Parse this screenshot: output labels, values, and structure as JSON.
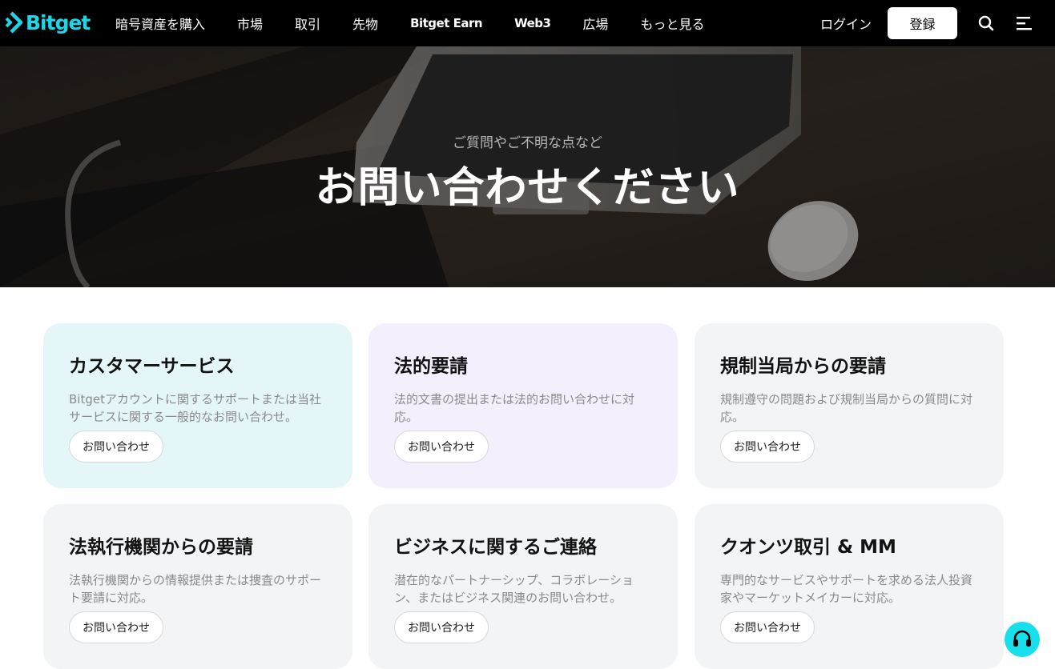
{
  "header": {
    "logo_text": "Bitget",
    "nav": [
      {
        "label": "暗号資産を購入",
        "bold": false
      },
      {
        "label": "市場",
        "bold": false
      },
      {
        "label": "取引",
        "bold": false
      },
      {
        "label": "先物",
        "bold": false
      },
      {
        "label": "Bitget Earn",
        "bold": true
      },
      {
        "label": "Web3",
        "bold": true
      },
      {
        "label": "広場",
        "bold": false
      },
      {
        "label": "もっと見る",
        "bold": false
      }
    ],
    "login_label": "ログイン",
    "register_label": "登録"
  },
  "hero": {
    "subtitle": "ご質問やご不明な点など",
    "title": "お問い合わせください"
  },
  "cards": [
    {
      "title": "カスタマーサービス",
      "description": "Bitgetアカウントに関するサポートまたは当社サービスに関する一般的なお問い合わせ。",
      "button": "お問い合わせ",
      "tone": "cyan"
    },
    {
      "title": "法的要請",
      "description": "法的文書の提出または法的お問い合わせに対応。",
      "button": "お問い合わせ",
      "tone": "lavender"
    },
    {
      "title": "規制当局からの要請",
      "description": "規制遵守の問題および規制当局からの質問に対応。",
      "button": "お問い合わせ",
      "tone": "grey"
    },
    {
      "title": "法執行機関からの要請",
      "description": "法執行機関からの情報提供または捜査のサポート要請に対応。",
      "button": "お問い合わせ",
      "tone": "grey"
    },
    {
      "title": "ビジネスに関するご連絡",
      "description": "潜在的なパートナーシップ、コラボレーション、またはビジネス関連のお問い合わせ。",
      "button": "お問い合わせ",
      "tone": "grey"
    },
    {
      "title": "クオンツ取引 & MM",
      "description": "専門的なサービスやサポートを求める法人投資家やマーケットメイカーに対応。",
      "button": "お問い合わせ",
      "tone": "grey"
    }
  ],
  "colors": {
    "brand": "#1ed6e8",
    "header_bg": "#000000",
    "card_cyan": "#e4f6f8",
    "card_lavender": "#f4effd",
    "card_grey": "#f3f4f5",
    "support_fab": "#17e0ec"
  },
  "icons": {
    "search": "search-icon",
    "menu": "menu-icon",
    "support": "headset-icon"
  }
}
